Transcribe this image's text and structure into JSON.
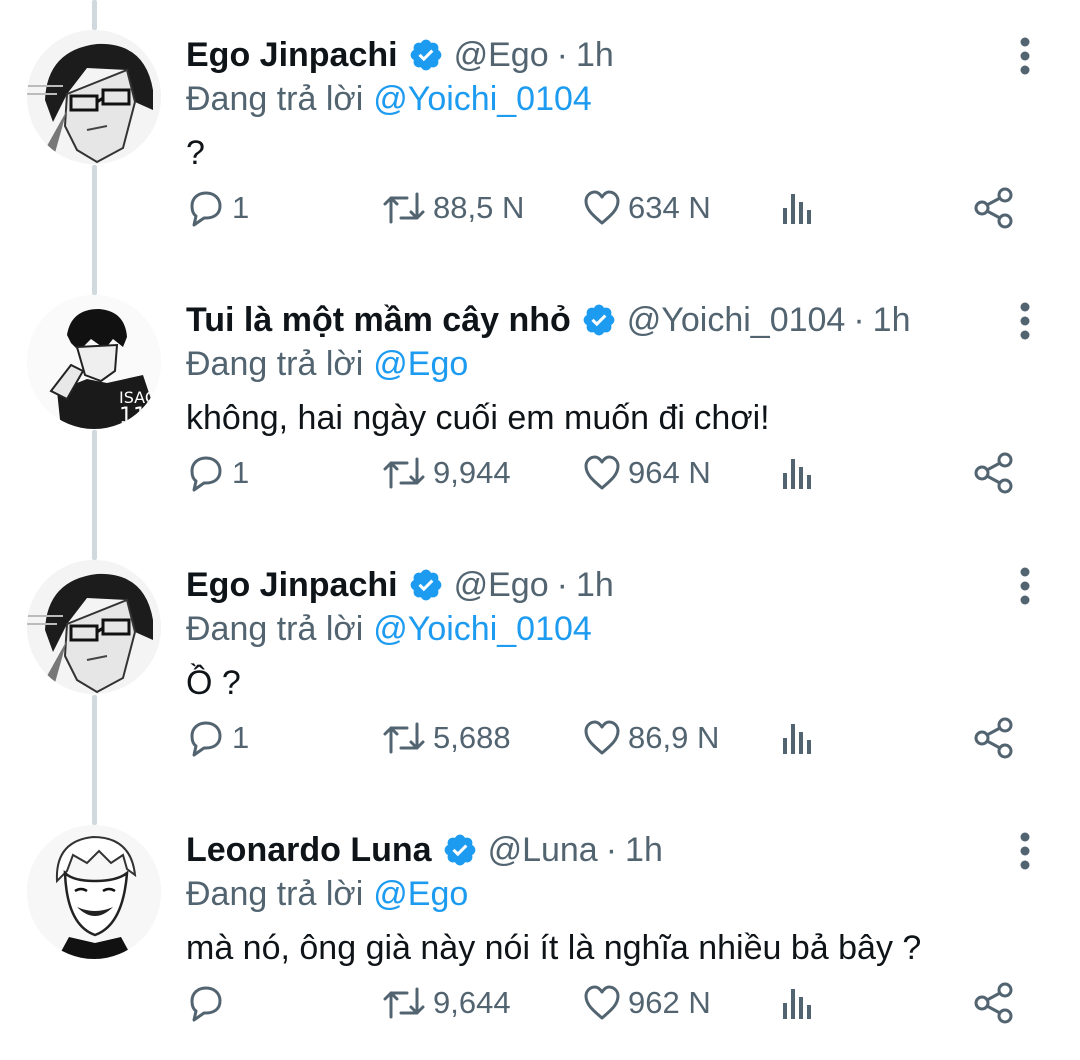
{
  "tweets": [
    {
      "name": "Ego Jinpachi",
      "handle": "@Ego",
      "time": "1h",
      "reply_prefix": "Đang trả lời",
      "reply_to": "@Yoichi_0104",
      "text": "?",
      "replies": "1",
      "retweets": "88,5 N",
      "likes": "634 N",
      "avatar": "ego-avatar"
    },
    {
      "name": "Tui là một mầm cây nhỏ",
      "handle": "@Yoichi_0104",
      "time": "1h",
      "reply_prefix": "Đang trả lời",
      "reply_to": "@Ego",
      "text": "không, hai ngày cuối em muốn đi chơi!",
      "replies": "1",
      "retweets": "9,944",
      "likes": "964 N",
      "avatar": "isagi-avatar"
    },
    {
      "name": "Ego Jinpachi",
      "handle": "@Ego",
      "time": "1h",
      "reply_prefix": "Đang trả lời",
      "reply_to": "@Yoichi_0104",
      "text": "Ồ ?",
      "replies": "1",
      "retweets": "5,688",
      "likes": "86,9 N",
      "avatar": "ego-avatar"
    },
    {
      "name": "Leonardo Luna",
      "handle": "@Luna",
      "time": "1h",
      "reply_prefix": "Đang trả lời",
      "reply_to": "@Ego",
      "text": "mà nó, ông già này nói ít là nghĩa nhiều bả bây ?",
      "replies": "",
      "retweets": "9,644",
      "likes": "962 N",
      "avatar": "luna-avatar"
    }
  ],
  "separator": "·",
  "colors": {
    "text": "#0f1419",
    "muted": "#536471",
    "accent": "#1d9bf0",
    "thread_line": "#cfd9de"
  }
}
